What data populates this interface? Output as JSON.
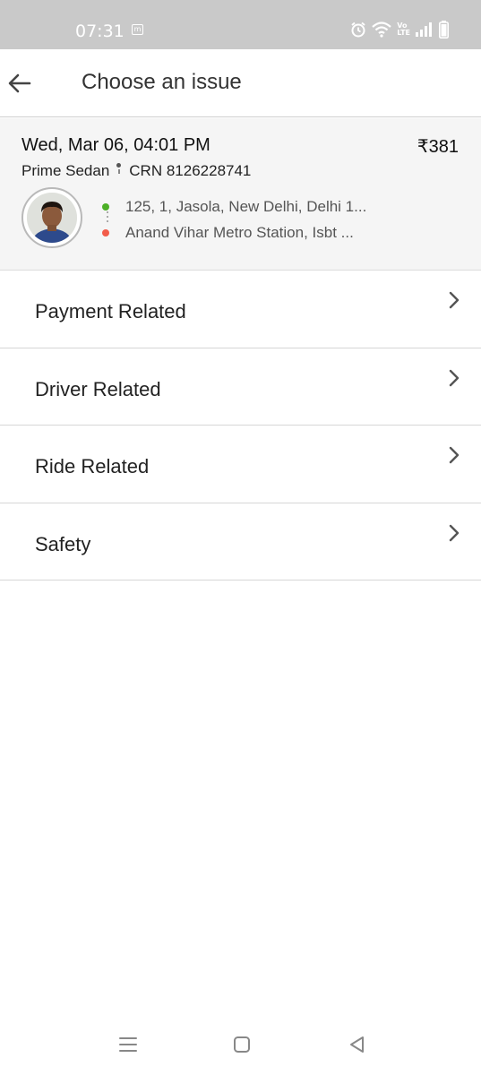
{
  "status_bar": {
    "time": "07:31",
    "notif_badge": "m",
    "icons": [
      "alarm-icon",
      "wifi-icon",
      "volte-icon",
      "signal-icon",
      "battery-icon"
    ],
    "volte_text_top": "Vo",
    "volte_text_bottom": "LTE"
  },
  "header": {
    "title": "Choose an issue",
    "back_icon": "arrow-left-icon"
  },
  "ride": {
    "date": "Wed, Mar 06, 04:01 PM",
    "fare": "₹381",
    "car_type": "Prime Sedan",
    "crn": "CRN 8126228741",
    "pickup": "125, 1, Jasola, New Delhi, Delhi 1...",
    "drop": "Anand Vihar Metro Station, Isbt ...",
    "pickup_color": "#4caf27",
    "drop_color": "#f25c4a"
  },
  "menu": {
    "items": [
      {
        "label": "Payment Related"
      },
      {
        "label": "Driver Related"
      },
      {
        "label": "Ride Related"
      },
      {
        "label": "Safety"
      }
    ]
  },
  "nav_bar": {
    "icons": [
      "menu-icon",
      "home-icon",
      "back-triangle-icon"
    ]
  }
}
